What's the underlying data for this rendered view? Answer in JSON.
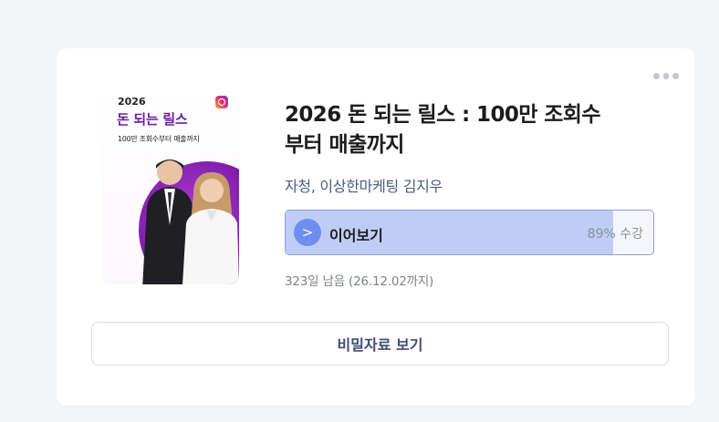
{
  "course": {
    "title_line1": "2026 돈 되는 릴스 : 100만 조회수",
    "title_line2": "부터 매출까지",
    "author": "자청, 이상한마케팅 김지우",
    "thumbnail": {
      "year": "2026",
      "title": "돈 되는 릴스",
      "subtitle": "100만 조회수부터 매출까지",
      "brand_icon": "instagram-icon"
    }
  },
  "progress": {
    "button_label": "이어보기",
    "play_glyph": ">",
    "percent_value": 89,
    "percent_label": "89%",
    "percent_suffix": "수강"
  },
  "remaining_text": "323일 남음 (26.12.02까지)",
  "secret_button_label": "비밀자료 보기",
  "colors": {
    "accent": "#6f8ff0",
    "progress_fill": "#bfcdf6",
    "progress_border": "#8ea0dc",
    "author": "#4a5b85",
    "thumbnail_title": "#6a1fa7"
  }
}
